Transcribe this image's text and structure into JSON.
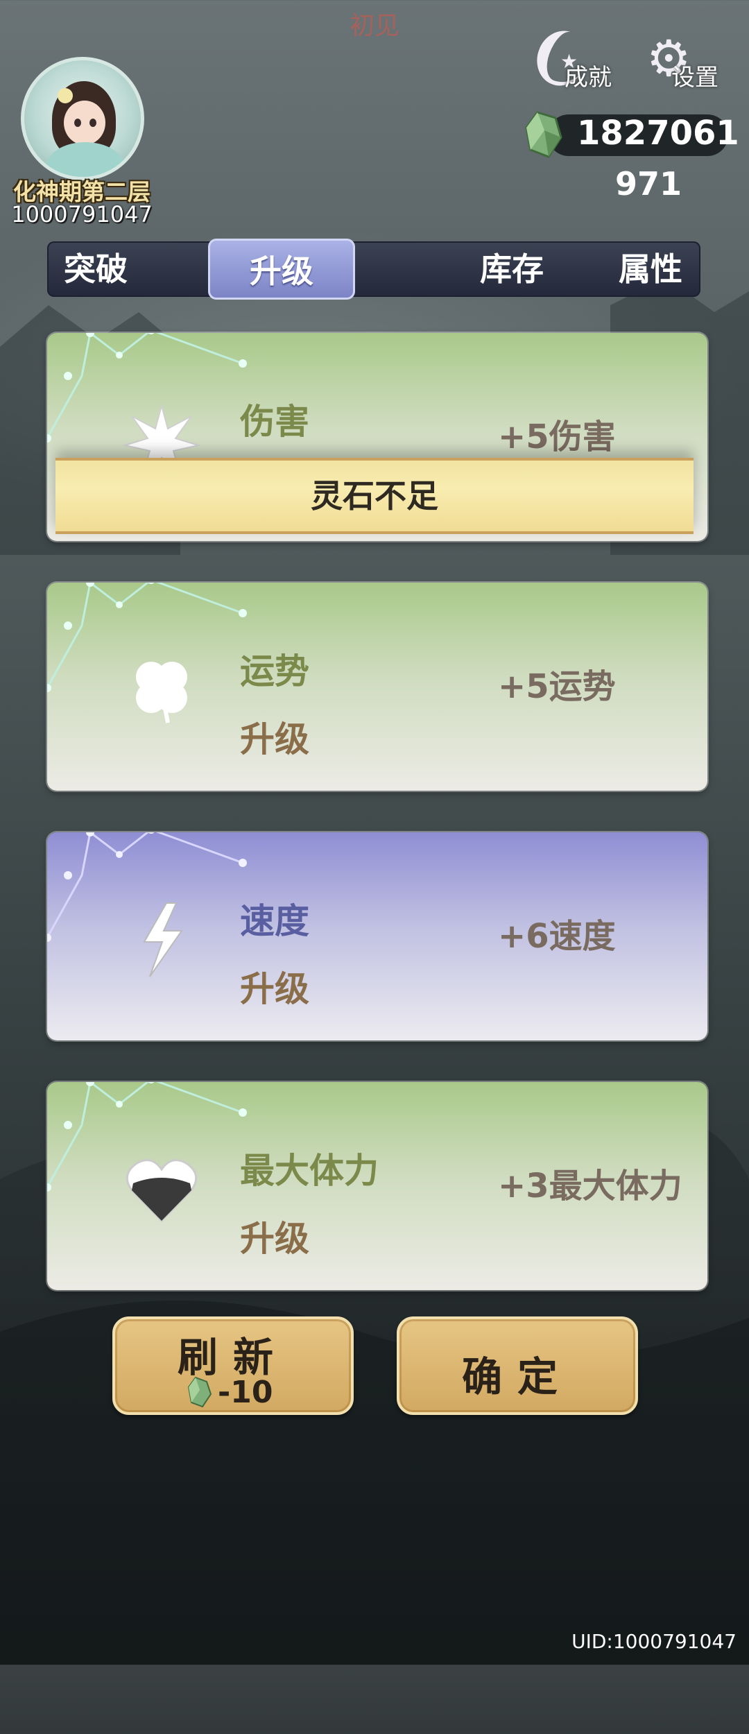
{
  "header": {
    "title": "初见",
    "achievements_label": "成就",
    "settings_label": "设置"
  },
  "player": {
    "realm": "化神期第二层",
    "id": "1000791047"
  },
  "currency": {
    "spirit_stones": "1827061",
    "secondary": "971"
  },
  "tabs": [
    {
      "label": "突破"
    },
    {
      "label": "升级"
    },
    {
      "label": "库存"
    },
    {
      "label": "属性"
    }
  ],
  "active_tab": "升级",
  "cards": [
    {
      "title": "伤害",
      "action": "",
      "effect": "+5伤害",
      "icon": "burst-icon",
      "theme": "green"
    },
    {
      "title": "运势",
      "action": "升级",
      "effect": "+5运势",
      "icon": "clover-icon",
      "theme": "green"
    },
    {
      "title": "速度",
      "action": "升级",
      "effect": "+6速度",
      "icon": "lightning-icon",
      "theme": "purple"
    },
    {
      "title": "最大体力",
      "action": "升级",
      "effect": "+3最大体力",
      "icon": "heart-icon",
      "theme": "green"
    }
  ],
  "toast": {
    "message": "灵石不足"
  },
  "buttons": {
    "refresh_label": "刷新",
    "refresh_cost": "-10",
    "confirm_label": "确定"
  },
  "footer": {
    "uid": "UID:1000791047"
  },
  "colors": {
    "card_green": "#a9c98a",
    "card_purple": "#8f8ed4",
    "tab_active": "#8e96d4",
    "button_gold": "#dcb670",
    "toast_yellow": "#f6e8aa"
  }
}
